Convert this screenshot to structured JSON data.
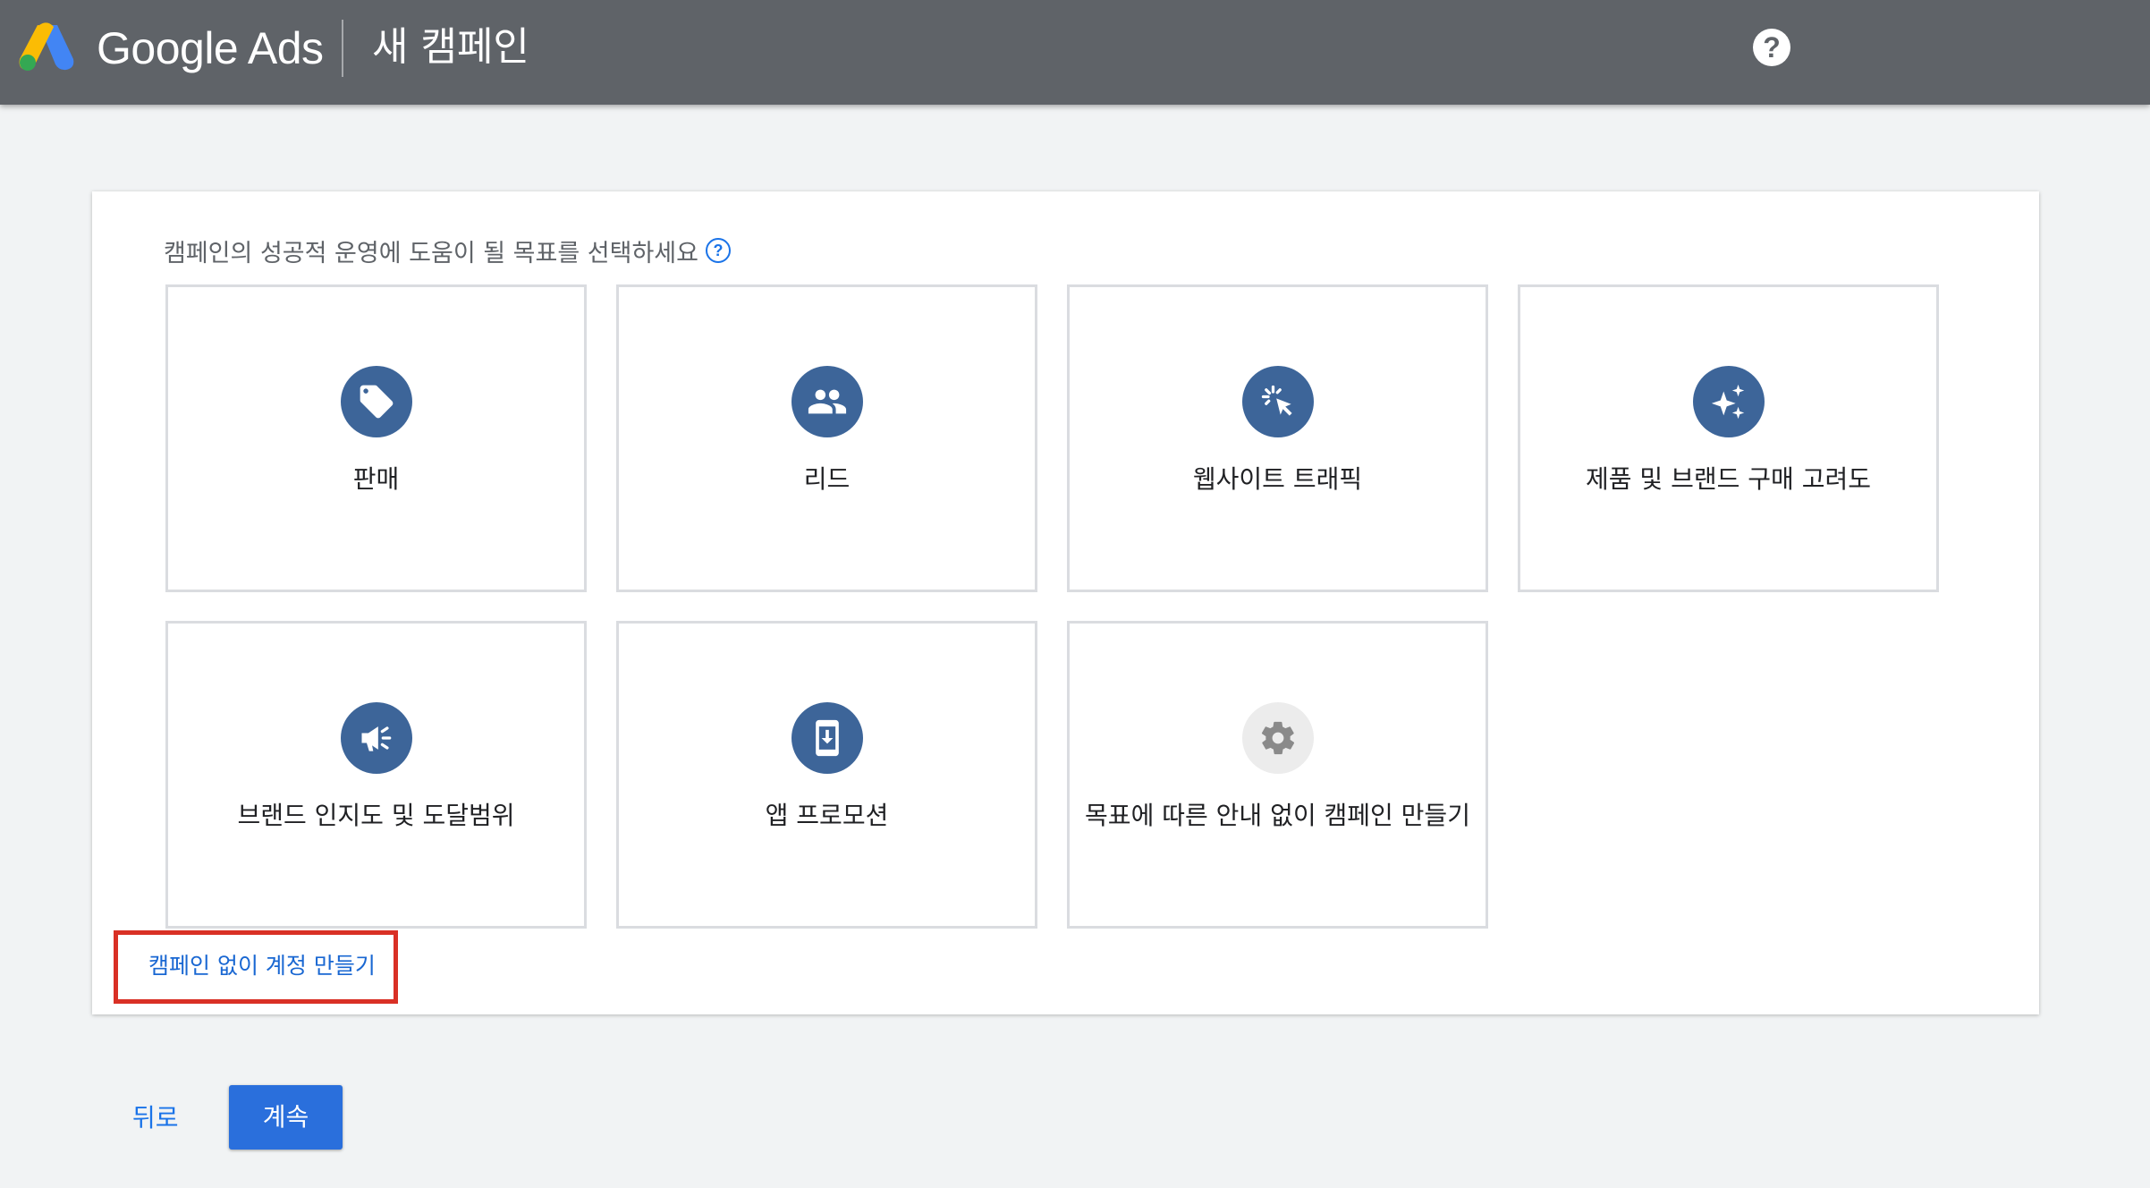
{
  "header": {
    "brand": "Google Ads",
    "title": "새 캠페인",
    "help_symbol": "?"
  },
  "goal_selection": {
    "prompt": "캠페인의 성공적 운영에 도움이 될 목표를 선택하세요",
    "help_symbol": "?",
    "goals": [
      {
        "label": "판매",
        "icon": "tag-icon"
      },
      {
        "label": "리드",
        "icon": "people-icon"
      },
      {
        "label": "웹사이트 트래픽",
        "icon": "cursor-click-icon"
      },
      {
        "label": "제품 및 브랜드 구매 고려도",
        "icon": "sparkle-icon"
      },
      {
        "label": "브랜드 인지도 및 도달범위",
        "icon": "megaphone-icon"
      },
      {
        "label": "앱 프로모션",
        "icon": "mobile-download-icon"
      },
      {
        "label": "목표에 따른 안내 없이 캠페인 만들기",
        "icon": "gear-icon"
      }
    ],
    "create_account_link": "캠페인 없이 계정 만들기"
  },
  "footer": {
    "back_label": "뒤로",
    "continue_label": "계속"
  },
  "colors": {
    "header_bg": "#5f6368",
    "icon_circle": "#3d6599",
    "link": "#1a73e8",
    "primary_button": "#2a6fdc",
    "highlight_border": "#d93025"
  }
}
